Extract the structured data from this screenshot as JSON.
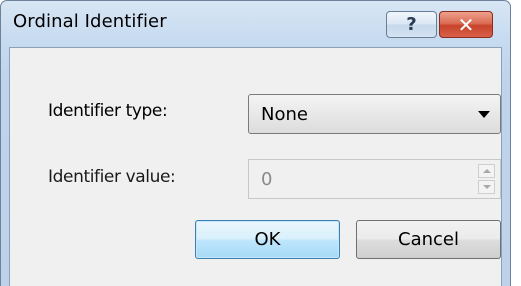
{
  "window": {
    "title": "Ordinal Identifier",
    "help_label": "?",
    "close_label": "✕"
  },
  "form": {
    "identifier_type": {
      "label": "Identifier type:",
      "value": "None"
    },
    "identifier_value": {
      "label": "Identifier value:",
      "value": "0",
      "enabled": false
    }
  },
  "buttons": {
    "ok_label": "OK",
    "cancel_label": "Cancel"
  },
  "icons": {
    "help": "question-mark-icon",
    "close": "close-x-icon",
    "dropdown": "chevron-down-icon",
    "spin_up": "arrow-up-icon",
    "spin_down": "arrow-down-icon"
  },
  "colors": {
    "title_bar": "#c6daf0",
    "client_bg": "#f0f0f0",
    "close_button": "#c8442b",
    "default_button": "#bee6fd"
  }
}
